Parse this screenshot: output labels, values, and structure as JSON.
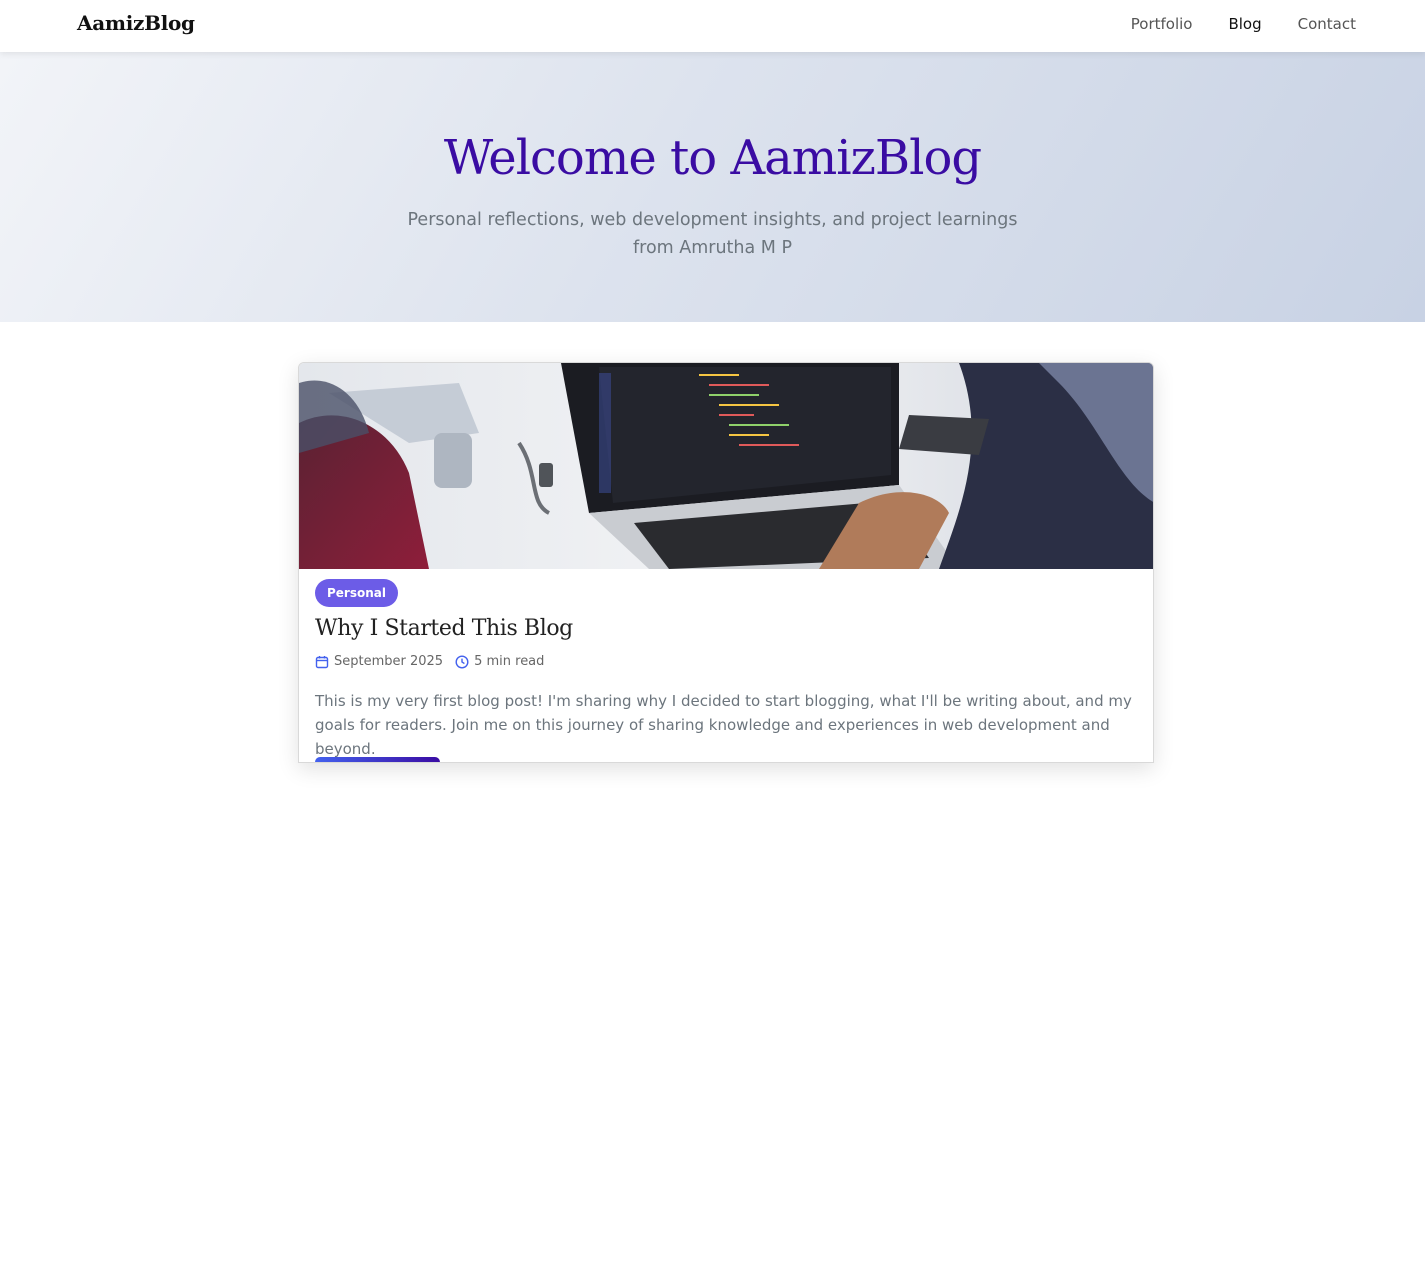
{
  "navbar": {
    "brand": "AamizBlog",
    "links": [
      {
        "label": "Portfolio",
        "active": false
      },
      {
        "label": "Blog",
        "active": true
      },
      {
        "label": "Contact",
        "active": false
      }
    ]
  },
  "hero": {
    "title": "Welcome to AamizBlog",
    "subtitle": "Personal reflections, web development insights, and project learnings from Amrutha M P"
  },
  "post": {
    "category": "Personal",
    "title": "Why I Started This Blog",
    "date": "September 2025",
    "read_time": "5 min read",
    "excerpt": "This is my very first blog post! I'm sharing why I decided to start blogging, what I'll be writing about, and my goals for readers. Join me on this journey of sharing knowledge and experiences in web development and beyond.",
    "date_icon": "calendar-icon",
    "time_icon": "clock-icon"
  },
  "colors": {
    "accent": "#3a0ca3",
    "badge": "#6c5ce7",
    "icon": "#4361ee"
  }
}
